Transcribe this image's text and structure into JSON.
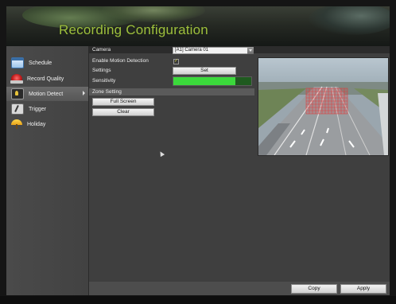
{
  "header": {
    "title": "Recording Configuration"
  },
  "sidebar": {
    "items": [
      {
        "label": "Schedule",
        "icon": "calendar-icon",
        "active": false
      },
      {
        "label": "Record Quality",
        "icon": "record-quality-icon",
        "active": false
      },
      {
        "label": "Motion Detect",
        "icon": "motion-detect-icon",
        "active": true
      },
      {
        "label": "Trigger",
        "icon": "trigger-icon",
        "active": false
      },
      {
        "label": "Holiday",
        "icon": "holiday-icon",
        "active": false
      }
    ]
  },
  "main": {
    "camera_label": "Camera",
    "camera_value": "[A1] Camera 01",
    "enable_motion_label": "Enable Motion Detection",
    "enable_motion_checked": true,
    "settings_label": "Settings",
    "set_button": "Set",
    "sensitivity_label": "Sensitivity",
    "sensitivity_level": 0.8,
    "zone_setting_label": "Zone Setting",
    "full_screen_button": "Full Screen",
    "clear_button": "Clear",
    "copy_button": "Copy",
    "apply_button": "Apply"
  },
  "colors": {
    "title": "#9ebf3e",
    "slider_fill": "#3bd93b",
    "slider_track": "#1f5a1f",
    "zone_grid": "#e23b3b"
  }
}
